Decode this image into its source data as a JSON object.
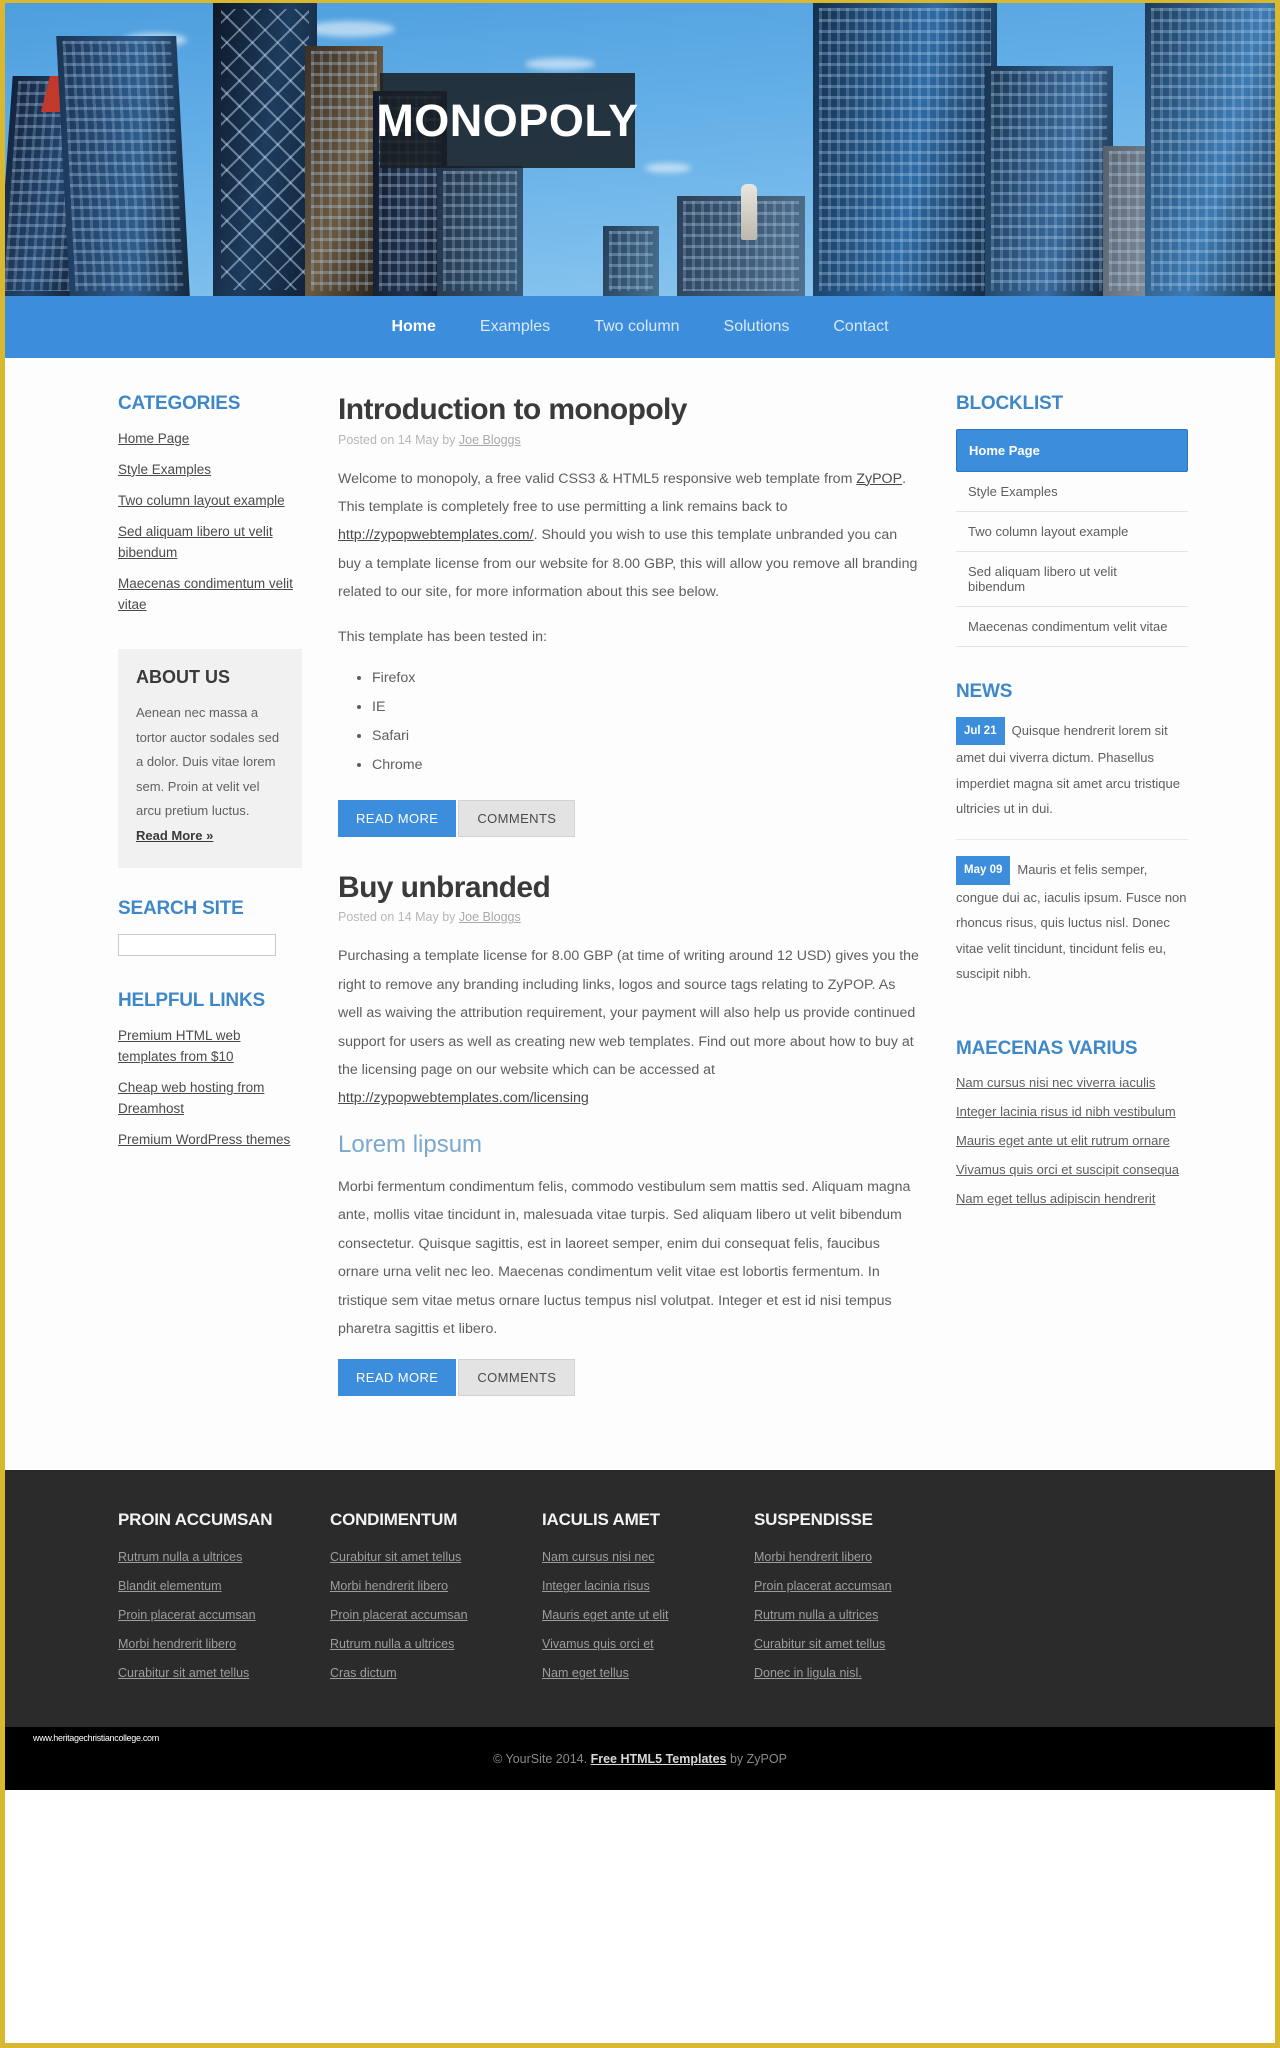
{
  "site": {
    "logo_text": "MONOPOLY"
  },
  "nav": {
    "items": [
      {
        "label": "Home",
        "active": true
      },
      {
        "label": "Examples",
        "active": false
      },
      {
        "label": "Two column",
        "active": false
      },
      {
        "label": "Solutions",
        "active": false
      },
      {
        "label": "Contact",
        "active": false
      }
    ]
  },
  "sidebar_left": {
    "categories": {
      "title": "CATEGORIES",
      "items": [
        "Home Page",
        "Style Examples",
        "Two column layout example",
        "Sed aliquam libero ut velit bibendum",
        "Maecenas condimentum velit vitae"
      ]
    },
    "about": {
      "title": "ABOUT US",
      "text": "Aenean nec massa a tortor auctor sodales sed a dolor. Duis vitae lorem sem. Proin at velit vel arcu pretium luctus. ",
      "read_more": "Read More »"
    },
    "search": {
      "title": "SEARCH SITE",
      "value": "",
      "placeholder": ""
    },
    "helpful_links": {
      "title": "HELPFUL LINKS",
      "items": [
        "Premium HTML web templates from $10",
        "Cheap web hosting from Dreamhost",
        "Premium WordPress themes"
      ]
    }
  },
  "main": {
    "posts": [
      {
        "title": "Introduction to monopoly",
        "meta_prefix": "Posted on 14 May by ",
        "meta_author": "Joe Bloggs",
        "para_1a": "Welcome to monopoly, a free valid CSS3 & HTML5 responsive web template from ",
        "link_1": "ZyPOP",
        "para_1b": ". This template is completely free to use permitting a link remains back to ",
        "link_2": "http://zypopwebtemplates.com/",
        "para_1c": ". Should you wish to use this template unbranded you can buy a template license from our website for 8.00 GBP, this will allow you remove all branding related to our site, for more information about this see below.",
        "tested_label": "This template has been tested in:",
        "browsers": [
          "Firefox",
          "IE",
          "Safari",
          "Chrome"
        ],
        "btn_read_more": "READ MORE",
        "btn_comments": "COMMENTS"
      },
      {
        "title": "Buy unbranded",
        "meta_prefix": "Posted on 14 May by ",
        "meta_author": "Joe Bloggs",
        "para_2a": "Purchasing a template license for 8.00 GBP (at time of writing around 12 USD) gives you the right to remove any branding including links, logos and source tags relating to ZyPOP. As well as waiving the attribution requirement, your payment will also help us provide continued support for users as well as creating new web templates. Find out more about how to buy at the licensing page on our website which can be accessed at ",
        "link_3": "http://zypopwebtemplates.com/licensing",
        "subhead": "Lorem lipsum",
        "para_3": "Morbi fermentum condimentum felis, commodo vestibulum sem mattis sed. Aliquam magna ante, mollis vitae tincidunt in, malesuada vitae turpis. Sed aliquam libero ut velit bibendum consectetur. Quisque sagittis, est in laoreet semper, enim dui consequat felis, faucibus ornare urna velit nec leo. Maecenas condimentum velit vitae est lobortis fermentum. In tristique sem vitae metus ornare luctus tempus nisl volutpat. Integer et est id nisi tempus pharetra sagittis et libero.",
        "btn_read_more": "READ MORE",
        "btn_comments": "COMMENTS"
      }
    ]
  },
  "sidebar_right": {
    "blocklist": {
      "title": "BLOCKLIST",
      "items": [
        {
          "label": "Home Page",
          "active": true
        },
        {
          "label": "Style Examples",
          "active": false
        },
        {
          "label": "Two column layout example",
          "active": false
        },
        {
          "label": "Sed aliquam libero ut velit bibendum",
          "active": false
        },
        {
          "label": "Maecenas condimentum velit vitae",
          "active": false
        }
      ]
    },
    "news": {
      "title": "NEWS",
      "items": [
        {
          "date": "Jul 21",
          "text": "Quisque hendrerit lorem sit amet dui viverra dictum. Phasellus imperdiet magna sit amet arcu tristique ultricies ut in dui."
        },
        {
          "date": "May 09",
          "text": "Mauris et felis semper, congue dui ac, iaculis ipsum. Fusce non rhoncus risus, quis luctus nisl. Donec vitae velit tincidunt, tincidunt felis eu, suscipit nibh."
        }
      ]
    },
    "varius": {
      "title": "MAECENAS VARIUS",
      "items": [
        "Nam cursus nisi nec viverra iaculis",
        "Integer lacinia risus id nibh vestibulum",
        "Mauris eget ante ut elit rutrum ornare",
        "Vivamus quis orci et suscipit consequa",
        "Nam eget tellus adipiscin hendrerit"
      ]
    }
  },
  "footer": {
    "columns": [
      {
        "title": "PROIN ACCUMSAN",
        "items": [
          "Rutrum nulla a ultrices",
          "Blandit elementum",
          "Proin placerat accumsan",
          "Morbi hendrerit libero",
          "Curabitur sit amet tellus"
        ]
      },
      {
        "title": "CONDIMENTUM",
        "items": [
          "Curabitur sit amet tellus",
          "Morbi hendrerit libero",
          "Proin placerat accumsan",
          "Rutrum nulla a ultrices",
          "Cras dictum"
        ]
      },
      {
        "title": "IACULIS AMET",
        "items": [
          "Nam cursus nisi nec",
          "Integer lacinia risus",
          "Mauris eget ante ut elit",
          "Vivamus quis orci et",
          "Nam eget tellus"
        ]
      },
      {
        "title": "SUSPENDISSE",
        "items": [
          "Morbi hendrerit libero",
          "Proin placerat accumsan",
          "Rutrum nulla a ultrices",
          "Curabitur sit amet tellus",
          "Donec in ligula nisl."
        ]
      }
    ],
    "copyright_prefix": "© YourSite 2014. ",
    "copyright_link": "Free HTML5 Templates",
    "copyright_suffix": " by ZyPOP",
    "watermark": "www.heritagechristiancollege.com"
  },
  "colors": {
    "accent": "#3c8ddc",
    "heading": "#3e88c9",
    "frame": "#d9b830",
    "footer_bg": "#2b2b2b"
  }
}
